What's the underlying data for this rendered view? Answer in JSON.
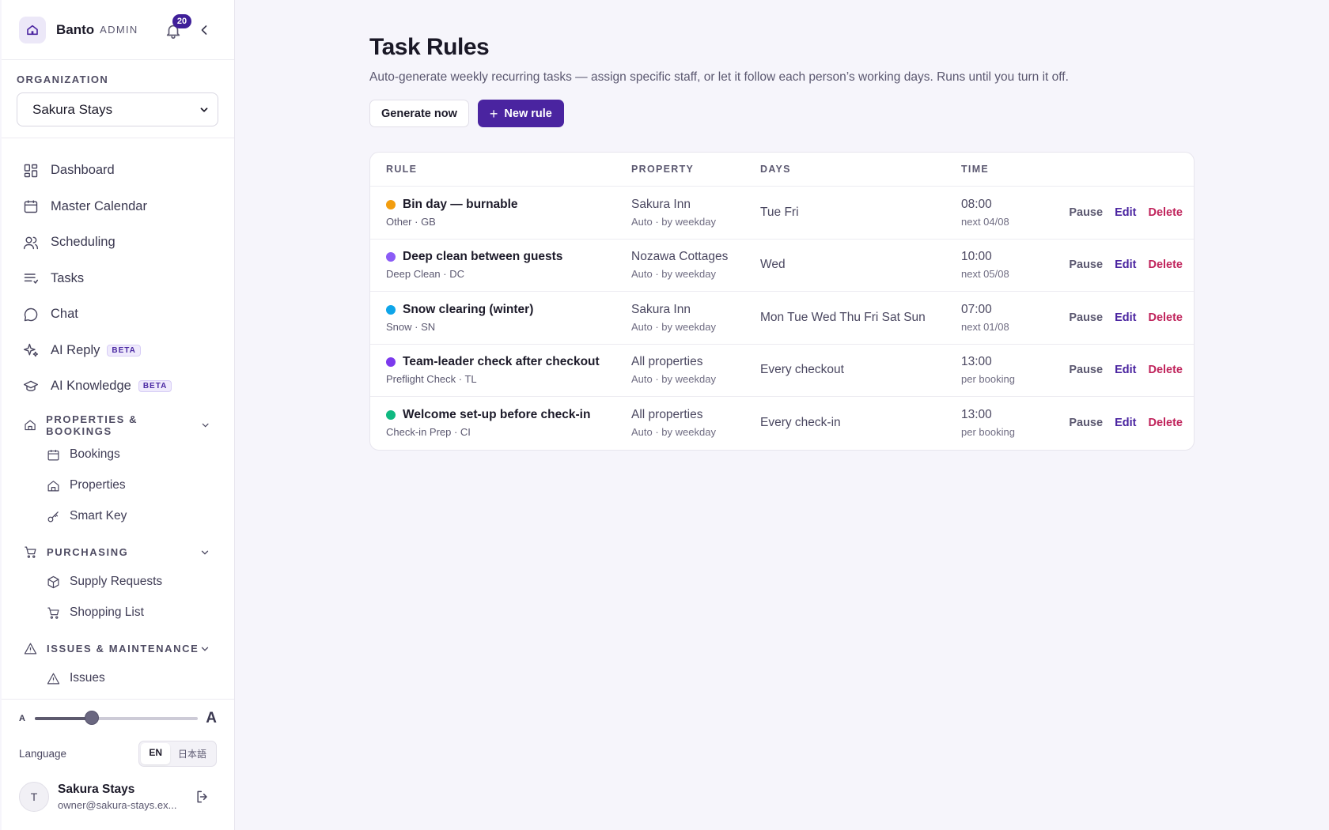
{
  "brand": {
    "name": "Banto",
    "role": "ADMIN",
    "notification_count": "20"
  },
  "org": {
    "label": "ORGANIZATION",
    "selected": "Sakura Stays"
  },
  "nav": {
    "items": [
      {
        "label": "Dashboard",
        "icon": "grid-icon"
      },
      {
        "label": "Master Calendar",
        "icon": "calendar-icon"
      },
      {
        "label": "Scheduling",
        "icon": "users-icon"
      },
      {
        "label": "Tasks",
        "icon": "list-icon"
      },
      {
        "label": "Chat",
        "icon": "chat-icon"
      },
      {
        "label": "AI Reply",
        "icon": "sparkle-icon",
        "badge": "BETA"
      },
      {
        "label": "AI Knowledge",
        "icon": "graduation-cap-icon",
        "badge": "BETA"
      }
    ],
    "sections": [
      {
        "title": "PROPERTIES & BOOKINGS",
        "icon": "home-icon",
        "items": [
          {
            "label": "Bookings",
            "icon": "calendar-icon"
          },
          {
            "label": "Properties",
            "icon": "home-icon"
          },
          {
            "label": "Smart Key",
            "icon": "key-icon"
          }
        ]
      },
      {
        "title": "PURCHASING",
        "icon": "cart-icon",
        "items": [
          {
            "label": "Supply Requests",
            "icon": "box-icon"
          },
          {
            "label": "Shopping List",
            "icon": "cart-icon"
          }
        ]
      },
      {
        "title": "ISSUES & MAINTENANCE",
        "icon": "warning-icon",
        "items": [
          {
            "label": "Issues",
            "icon": "warning-icon"
          }
        ]
      }
    ]
  },
  "footer": {
    "font_small": "A",
    "font_large": "A",
    "font_scale_fraction": 0.35,
    "language_label": "Language",
    "languages": [
      "EN",
      "日本語"
    ],
    "active_language": "EN",
    "user": {
      "initial": "T",
      "name": "Sakura Stays",
      "email": "owner@sakura-stays.ex..."
    }
  },
  "page": {
    "title": "Task Rules",
    "subtitle": "Auto-generate weekly recurring tasks — assign specific staff, or let it follow each person’s working days. Runs until you turn it off.",
    "generate_label": "Generate now",
    "new_rule_label": "New rule"
  },
  "table": {
    "headers": {
      "rule": "RULE",
      "property": "PROPERTY",
      "days": "DAYS",
      "time": "TIME"
    },
    "action_labels": {
      "pause": "Pause",
      "edit": "Edit",
      "delete": "Delete"
    },
    "rows": [
      {
        "title": "Bin day — burnable",
        "meta": "Other · GB",
        "color": "#f29d0f",
        "property": "Sakura Inn",
        "property_meta": "Auto · by weekday",
        "days": "Tue Fri",
        "time": "08:00",
        "time_meta": "next 04/08"
      },
      {
        "title": "Deep clean between guests",
        "meta": "Deep Clean · DC",
        "color": "#8b5cf6",
        "property": "Nozawa Cottages",
        "property_meta": "Auto · by weekday",
        "days": "Wed",
        "time": "10:00",
        "time_meta": "next 05/08"
      },
      {
        "title": "Snow clearing (winter)",
        "meta": "Snow · SN",
        "color": "#0ea5e9",
        "property": "Sakura Inn",
        "property_meta": "Auto · by weekday",
        "days": "Mon Tue Wed Thu Fri Sat Sun",
        "time": "07:00",
        "time_meta": "next 01/08"
      },
      {
        "title": "Team-leader check after checkout",
        "meta": "Preflight Check · TL",
        "color": "#7c3aed",
        "property": "All properties",
        "property_meta": "Auto · by weekday",
        "days": "Every checkout",
        "time": "13:00",
        "time_meta": "per booking"
      },
      {
        "title": "Welcome set-up before check-in",
        "meta": "Check-in Prep · CI",
        "color": "#10b981",
        "property": "All properties",
        "property_meta": "Auto · by weekday",
        "days": "Every check-in",
        "time": "13:00",
        "time_meta": "per booking"
      }
    ]
  }
}
